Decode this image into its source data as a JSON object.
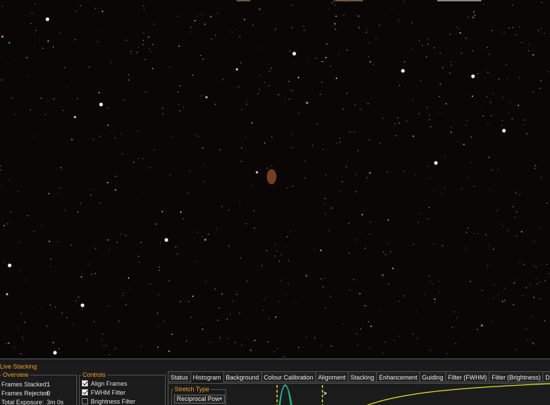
{
  "panel": {
    "title": "Live Stacking"
  },
  "overview": {
    "label": "Overview",
    "rows": [
      {
        "label": "Frames Stacked:",
        "value": "1"
      },
      {
        "label": "Frames Rejected:",
        "value": "0"
      },
      {
        "label": "Total Exposure:",
        "value": "3m 0s"
      }
    ]
  },
  "controls": {
    "label": "Controls",
    "items": [
      {
        "label": "Align Frames",
        "checked": true
      },
      {
        "label": "FWHM Filter",
        "checked": true
      },
      {
        "label": "Brightness Filter",
        "checked": false
      }
    ]
  },
  "tabs": [
    "Status",
    "Histogram",
    "Background",
    "Colour Calibration",
    "Alignment",
    "Stacking",
    "Enhancement",
    "Guiding",
    "Filter (FWHM)",
    "Filter (Brightness)",
    "Drift G"
  ],
  "active_tab": "Histogram",
  "histogram": {
    "stretch_label": "Stretch Type",
    "stretch_value": "Reciprocal Pow"
  },
  "colors": {
    "accent": "#f0a020",
    "sky": "#0b0606",
    "panel_bg": "#1b1b1b",
    "curve_yellow": "#e8e820",
    "hist_teal": "#20b0b0",
    "hist_green": "#30c040"
  }
}
